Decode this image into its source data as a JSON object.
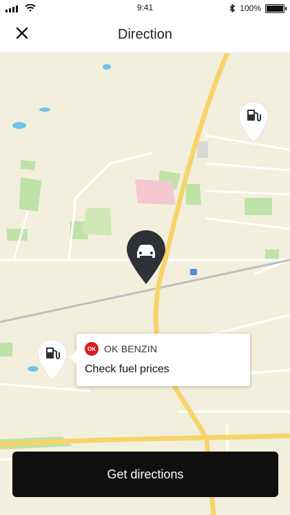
{
  "status_bar": {
    "time": "9:41",
    "battery": "100%",
    "icons": [
      "signal-icon",
      "wifi-icon",
      "bluetooth-icon",
      "battery-icon"
    ]
  },
  "header": {
    "title": "Direction",
    "close_icon": "close-icon"
  },
  "map": {
    "markers": [
      {
        "name": "fuel-pin-icon",
        "kind": "fuel-station"
      },
      {
        "name": "car-pin-icon",
        "kind": "current-vehicle"
      },
      {
        "name": "fuel-pin-icon",
        "kind": "fuel-station"
      }
    ],
    "colors": {
      "land": "#f3efdd",
      "roads_major": "#f7d46a",
      "roads_minor": "#ffffff",
      "green": "#bfe2a8",
      "water": "#6fc3ea",
      "pin_dark": "#2e3135",
      "brand_red": "#d81f26"
    }
  },
  "callout": {
    "brand": "OK BENZIN",
    "brand_logo_text": "OK",
    "action": "Check fuel prices"
  },
  "cta": {
    "label": "Get directions"
  }
}
